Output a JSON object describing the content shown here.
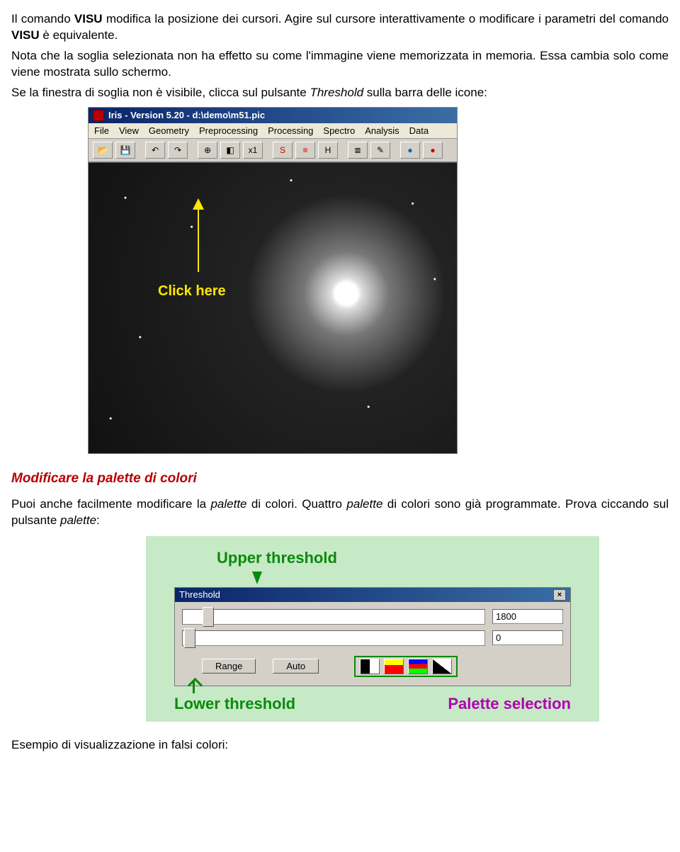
{
  "para1_a": "Il comando ",
  "para1_visu1": "VISU",
  "para1_b": " modifica la posizione dei cursori. Agire sul cursore interattivamente o modificare i parametri del comando ",
  "para1_visu2": "VISU",
  "para1_c": " è equivalente.",
  "para2": "Nota che la soglia selezionata non ha effetto su come l'immagine viene memorizzata in memoria. Essa cambia solo come viene mostrata sullo schermo.",
  "para3_a": "Se la finestra di soglia non è visibile, clicca sul pulsante ",
  "para3_threshold": "Threshold",
  "para3_b": " sulla barra delle icone:",
  "iris": {
    "title": "Iris - Version 5.20 - d:\\demo\\m51.pic",
    "menus": [
      "File",
      "View",
      "Geometry",
      "Preprocessing",
      "Processing",
      "Spectro",
      "Analysis",
      "Data"
    ],
    "toolbar_icons": [
      "open-icon",
      "save-icon",
      "undo-icon",
      "redo-icon",
      "target-icon",
      "threshold-icon",
      "x1-icon",
      "curve-icon",
      "histo-icon",
      "h-icon",
      "levels-icon",
      "marker-icon",
      "blue-dot-icon",
      "red-dot-icon"
    ],
    "click_here": "Click here"
  },
  "section_palette_title": "Modificare la palette di colori",
  "para4_a": "Puoi anche facilmente modificare la ",
  "para4_palette1": "palette",
  "para4_b": " di colori. Quattro ",
  "para4_palette2": "palette",
  "para4_c": " di colori sono già programmate. Prova ciccando sul pulsante ",
  "para4_palette3": "palette",
  "para4_d": ":",
  "threshold": {
    "upper_label": "Upper threshold",
    "lower_label": "Lower threshold",
    "palette_label": "Palette selection",
    "title": "Threshold",
    "upper_value": "1800",
    "lower_value": "0",
    "range_btn": "Range",
    "auto_btn": "Auto"
  },
  "footer": "Esempio di visualizzazione in falsi colori:"
}
